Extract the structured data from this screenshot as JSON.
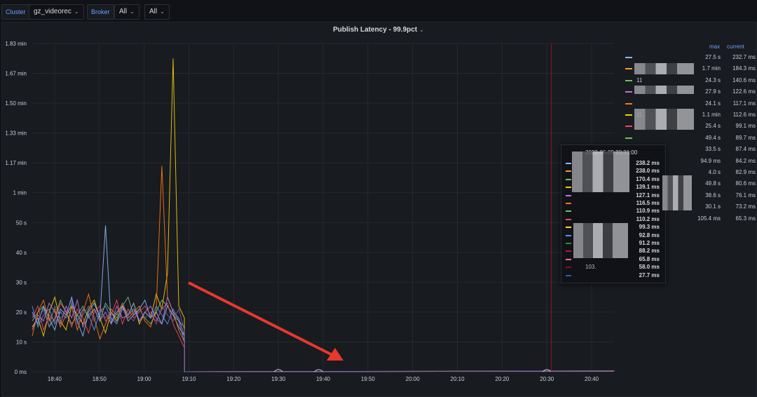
{
  "variables": {
    "cluster_label": "Cluster",
    "cluster_value": "gz_videorec",
    "broker_label": "Broker",
    "broker_value": "All",
    "third_value": "All"
  },
  "panel": {
    "title": "Publish Latency - 99.9pct"
  },
  "chart_data": {
    "type": "line",
    "title": "Publish Latency - 99.9pct",
    "xlabel": "",
    "ylabel": "",
    "x_ticks": [
      "18:40",
      "18:50",
      "19:00",
      "19:10",
      "19:20",
      "19:30",
      "19:40",
      "19:50",
      "20:00",
      "20:10",
      "20:20",
      "20:30",
      "20:40"
    ],
    "y_ticks": [
      "0 ms",
      "10 s",
      "20 s",
      "30 s",
      "40 s",
      "50 s",
      "1 min",
      "1.17 min",
      "1.33 min",
      "1.50 min",
      "1.67 min",
      "1.83 min"
    ],
    "ylim_seconds": [
      0,
      110
    ],
    "grid": true,
    "legend_placement": "right",
    "series_colors": [
      "#73bf69",
      "#f2cc0c",
      "#8ab8ff",
      "#ff780a",
      "#f2495c",
      "#5794f2",
      "#b877d9",
      "#705da0",
      "#37872d",
      "#fade2a",
      "#447ebc",
      "#c15c17",
      "#890f02",
      "#0a437c",
      "#6d1f62",
      "#e0752d",
      "#ccccdc"
    ],
    "series_values_seconds": [
      [
        17,
        20,
        22,
        15,
        18,
        24,
        20,
        16,
        19,
        22,
        18,
        21,
        17,
        23,
        20,
        18,
        22,
        25,
        19,
        21,
        18,
        16,
        20,
        24,
        22,
        19,
        17,
        15,
        0,
        0.3
      ],
      [
        15,
        18,
        12,
        20,
        25,
        17,
        14,
        22,
        19,
        16,
        21,
        24,
        18,
        13,
        20,
        17,
        22,
        19,
        23,
        16,
        20,
        18,
        26,
        21,
        33,
        105,
        22,
        18,
        0,
        0.2
      ],
      [
        20,
        16,
        22,
        18,
        14,
        21,
        19,
        25,
        17,
        12,
        20,
        23,
        18,
        49,
        16,
        20,
        22,
        17,
        19,
        21,
        24,
        18,
        20,
        16,
        22,
        19,
        15,
        12,
        0,
        0.2
      ],
      [
        12,
        20,
        24,
        17,
        21,
        15,
        19,
        22,
        14,
        20,
        26,
        18,
        11,
        16,
        21,
        19,
        23,
        18,
        20,
        22,
        17,
        15,
        21,
        69,
        25,
        20,
        14,
        10,
        0,
        0.3
      ],
      [
        18,
        22,
        14,
        19,
        17,
        23,
        20,
        15,
        21,
        18,
        13,
        20,
        22,
        17,
        19,
        24,
        16,
        21,
        18,
        20,
        22,
        19,
        17,
        21,
        23,
        16,
        12,
        8,
        0,
        0.2
      ],
      [
        22,
        15,
        19,
        21,
        16,
        20,
        18,
        23,
        17,
        21,
        19,
        14,
        20,
        22,
        18,
        16,
        21,
        19,
        23,
        17,
        20,
        18,
        22,
        19,
        16,
        21,
        17,
        10,
        0,
        0.2
      ],
      [
        14,
        19,
        17,
        23,
        20,
        16,
        22,
        18,
        24,
        15,
        19,
        21,
        17,
        20,
        16,
        22,
        18,
        19,
        21,
        17,
        20,
        22,
        18,
        16,
        25,
        20,
        18,
        12,
        0,
        0.2
      ],
      [
        19,
        17,
        21,
        15,
        22,
        18,
        20,
        24,
        16,
        19,
        22,
        17,
        21,
        18,
        20,
        16,
        23,
        19,
        17,
        21,
        18,
        20,
        16,
        22,
        19,
        17,
        21,
        14,
        0,
        0.2
      ]
    ],
    "series_x_start": "18:35",
    "series_x_end": "20:45"
  },
  "legend": {
    "col_max": "max",
    "col_current": "current",
    "rows": [
      {
        "color": "#8ab8ff",
        "name": "",
        "max": "27.5 s",
        "current": "232.7 ms"
      },
      {
        "color": "#ff9830",
        "name": "",
        "max": "1.7 min",
        "current": "184.3 ms"
      },
      {
        "color": "#73bf69",
        "name": "11",
        "max": "24.3 s",
        "current": "140.6 ms"
      },
      {
        "color": "#b877d9",
        "name": "",
        "max": "27.9 s",
        "current": "122.6 ms"
      },
      {
        "color": "#ff780a",
        "name": "",
        "max": "24.1 s",
        "current": "117.1 ms"
      },
      {
        "color": "#f2cc0c",
        "name": "11",
        "max": "1.1 min",
        "current": "112.6 ms"
      },
      {
        "color": "#f2495c",
        "name": "",
        "max": "25.4 s",
        "current": "99.1 ms"
      },
      {
        "color": "#73bf69",
        "name": "",
        "max": "49.4 s",
        "current": "89.7 ms"
      },
      {
        "color": "#5794f2",
        "name": "",
        "max": "33.5 s",
        "current": "87.4 ms"
      },
      {
        "color": "#fade2a",
        "name": "",
        "max": "94.9 ms",
        "current": "84.2 ms"
      },
      {
        "color": "#ff7383",
        "name": "0",
        "max": "4.0 s",
        "current": "82.9 ms"
      },
      {
        "color": "#37872d",
        "name": "0",
        "max": "49.8 s",
        "current": "80.6 ms"
      },
      {
        "color": "#ccccdc",
        "name": "0",
        "max": "38.6 s",
        "current": "76.1 ms"
      },
      {
        "color": "#c4162a",
        "name": "",
        "max": "30.1 s",
        "current": "73.2 ms"
      },
      {
        "color": "#1f60c4",
        "name": "30",
        "max": "105.4 ms",
        "current": "65.3 ms"
      }
    ]
  },
  "tooltip": {
    "time": "2022-06-09 20:31:00",
    "name_fragment": "103.",
    "rows": [
      {
        "color": "#8ab8ff",
        "value": "238.2 ms"
      },
      {
        "color": "#ff9830",
        "value": "238.0 ms"
      },
      {
        "color": "#73bf69",
        "value": "170.4 ms"
      },
      {
        "color": "#f2cc0c",
        "value": "139.1 ms"
      },
      {
        "color": "#b877d9",
        "value": "127.1 ms"
      },
      {
        "color": "#ff780a",
        "value": "116.5 ms"
      },
      {
        "color": "#73bf69",
        "value": "110.9 ms"
      },
      {
        "color": "#f2495c",
        "value": "110.2 ms"
      },
      {
        "color": "#fade2a",
        "value": "99.3 ms"
      },
      {
        "color": "#5794f2",
        "value": "92.8 ms"
      },
      {
        "color": "#37872d",
        "value": "91.2 ms"
      },
      {
        "color": "#c4162a",
        "value": "88.2 ms"
      },
      {
        "color": "#ff7383",
        "value": "65.8 ms"
      },
      {
        "color": "#890f02",
        "value": "58.0 ms"
      },
      {
        "color": "#1f60c4",
        "value": "27.7 ms"
      }
    ]
  },
  "annotation": {
    "arrow_color": "#e8382c"
  }
}
